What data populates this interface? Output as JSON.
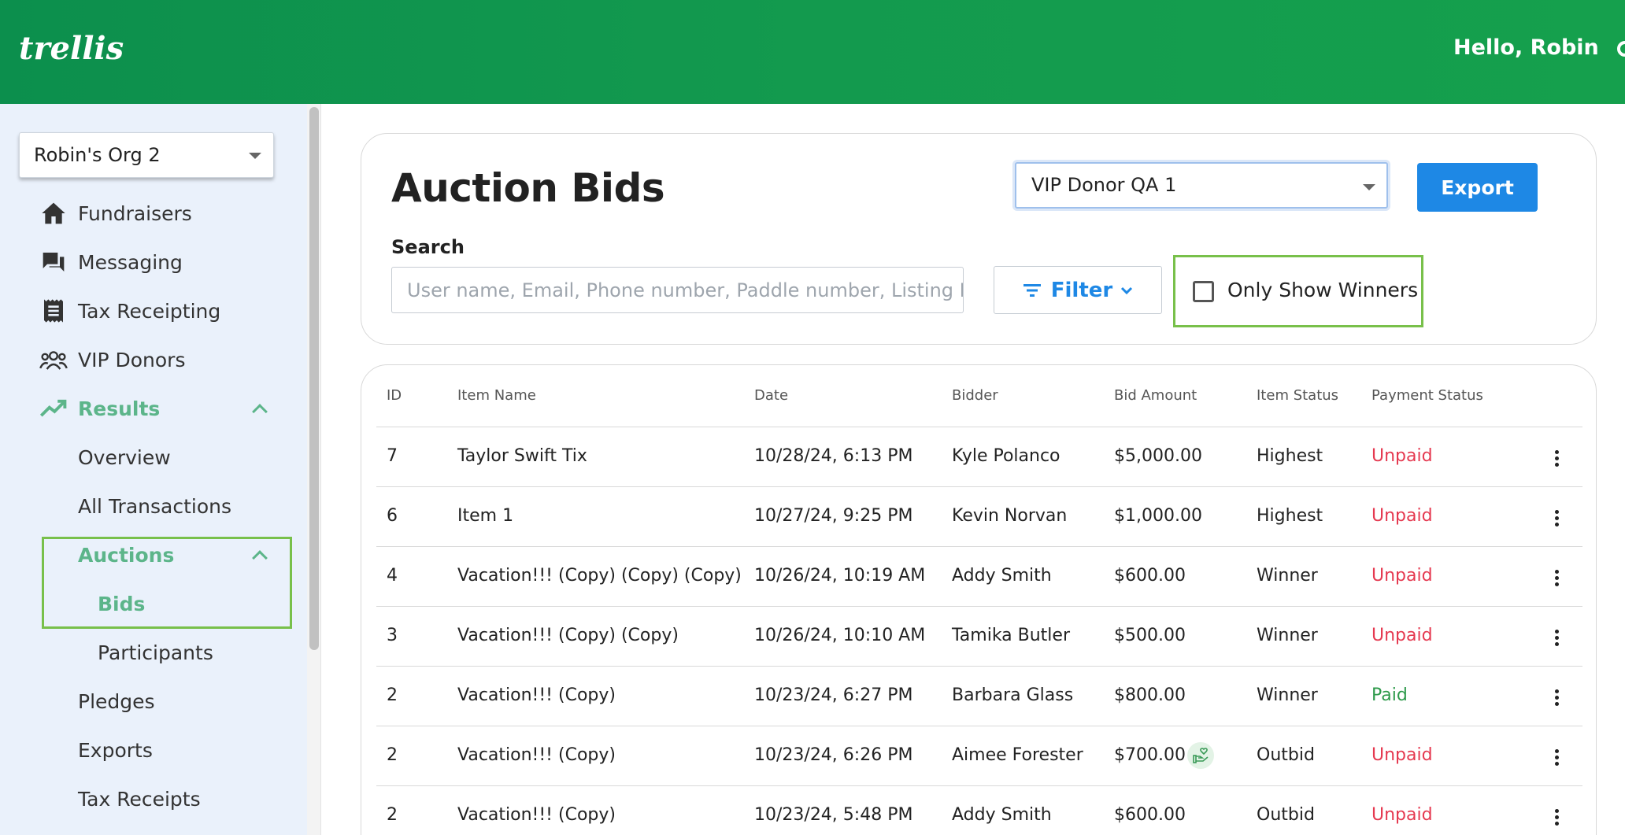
{
  "header": {
    "logo": "trellis",
    "greeting": "Hello, Robin"
  },
  "sidebar": {
    "org_select": "Robin's Org 2",
    "items": [
      {
        "label": "Fundraisers",
        "icon": "home-icon"
      },
      {
        "label": "Messaging",
        "icon": "chat-icon"
      },
      {
        "label": "Tax Receipting",
        "icon": "receipt-icon"
      },
      {
        "label": "VIP Donors",
        "icon": "group-icon"
      },
      {
        "label": "Results",
        "icon": "trending-up-icon"
      }
    ],
    "results_sub": {
      "overview": "Overview",
      "all_transactions": "All Transactions",
      "auctions": "Auctions"
    },
    "auctions_sub": {
      "bids": "Bids",
      "participants": "Participants"
    },
    "bottom": {
      "pledges": "Pledges",
      "exports": "Exports",
      "tax_receipts": "Tax Receipts"
    }
  },
  "main": {
    "title": "Auction Bids",
    "event_select": "VIP Donor QA 1",
    "export_label": "Export",
    "search_label": "Search",
    "search_placeholder": "User name, Email, Phone number, Paddle number, Listing ID",
    "filter_label": "Filter",
    "only_winners_label": "Only Show Winners",
    "columns": [
      "ID",
      "Item Name",
      "Date",
      "Bidder",
      "Bid Amount",
      "Item Status",
      "Payment Status"
    ],
    "rows": [
      {
        "id": "7",
        "item": "Taylor Swift Tix",
        "date": "10/28/24, 6:13 PM",
        "bidder": "Kyle Polanco",
        "amount": "$5,000.00",
        "item_status": "Highest",
        "payment": "Unpaid"
      },
      {
        "id": "6",
        "item": "Item 1",
        "date": "10/27/24, 9:25 PM",
        "bidder": "Kevin Norvan",
        "amount": "$1,000.00",
        "item_status": "Highest",
        "payment": "Unpaid"
      },
      {
        "id": "4",
        "item": "Vacation!!! (Copy) (Copy) (Copy)",
        "date": "10/26/24, 10:19 AM",
        "bidder": "Addy Smith",
        "amount": "$600.00",
        "item_status": "Winner",
        "payment": "Unpaid"
      },
      {
        "id": "3",
        "item": "Vacation!!! (Copy) (Copy)",
        "date": "10/26/24, 10:10 AM",
        "bidder": "Tamika Butler",
        "amount": "$500.00",
        "item_status": "Winner",
        "payment": "Unpaid"
      },
      {
        "id": "2",
        "item": "Vacation!!! (Copy)",
        "date": "10/23/24, 6:27 PM",
        "bidder": "Barbara Glass",
        "amount": "$800.00",
        "item_status": "Winner",
        "payment": "Paid"
      },
      {
        "id": "2",
        "item": "Vacation!!! (Copy)",
        "date": "10/23/24, 6:26 PM",
        "bidder": "Aimee Forester",
        "amount": "$700.00",
        "item_status": "Outbid",
        "payment": "Unpaid"
      },
      {
        "id": "2",
        "item": "Vacation!!! (Copy)",
        "date": "10/23/24, 5:48 PM",
        "bidder": "Addy Smith",
        "amount": "$600.00",
        "item_status": "Outbid",
        "payment": "Unpaid"
      }
    ]
  },
  "colors": {
    "brand_green": "#109a4e",
    "accent_blue": "#1e88e5",
    "unpaid_red": "#e53950",
    "paid_green": "#2e9a4b",
    "sidebar_active": "#5cb58a",
    "highlight_box": "#78c04a"
  }
}
